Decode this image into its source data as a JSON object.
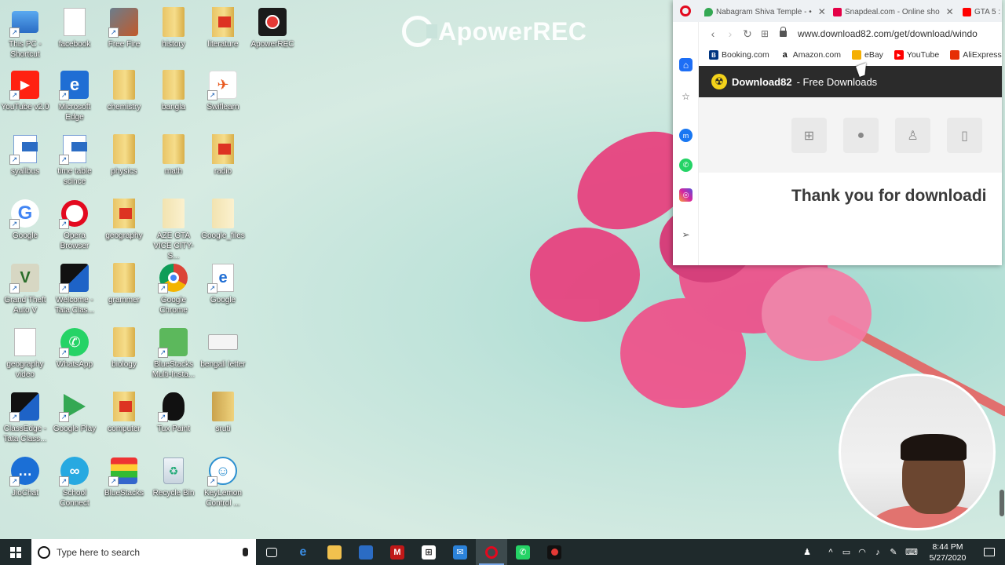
{
  "watermark": "ApowerREC",
  "desktop_icons": [
    {
      "label": "This PC - Shortcut"
    },
    {
      "label": "facebook"
    },
    {
      "label": "Free Fire"
    },
    {
      "label": "history"
    },
    {
      "label": "literature"
    },
    {
      "label": "ApowerREC"
    },
    {
      "label": "YouTube v2.0"
    },
    {
      "label": "Microsoft Edge"
    },
    {
      "label": "chemistry"
    },
    {
      "label": "bangla"
    },
    {
      "label": "Swiflearn"
    },
    {
      "label": "syallbus"
    },
    {
      "label": "time table scince"
    },
    {
      "label": "physics"
    },
    {
      "label": "math"
    },
    {
      "label": "radio"
    },
    {
      "label": "Google"
    },
    {
      "label": "Opera Browser"
    },
    {
      "label": "geography"
    },
    {
      "label": "AZE GTA VICE CITY-S..."
    },
    {
      "label": "Google_files"
    },
    {
      "label": "Grand Theft Auto V"
    },
    {
      "label": "Welcome - Tata Clas..."
    },
    {
      "label": "grammer"
    },
    {
      "label": "Google Chrome"
    },
    {
      "label": "Google"
    },
    {
      "label": "geography video"
    },
    {
      "label": "WhatsApp"
    },
    {
      "label": "biology"
    },
    {
      "label": "BlueStacks Multi-Insta..."
    },
    {
      "label": "bengali letter"
    },
    {
      "label": "ClassEdge - Tata Class..."
    },
    {
      "label": "Google Play"
    },
    {
      "label": "computer"
    },
    {
      "label": "Tux Paint"
    },
    {
      "label": "sruti"
    },
    {
      "label": "JioChat"
    },
    {
      "label": "School Connect"
    },
    {
      "label": "BlueStacks"
    },
    {
      "label": "Recycle Bin"
    },
    {
      "label": "KeyLemon Control ..."
    }
  ],
  "browser": {
    "tabs": [
      {
        "label": "Nabagram Shiva Temple - •"
      },
      {
        "label": "Snapdeal.com - Online sho"
      },
      {
        "label": "GTA 5 :"
      }
    ],
    "url": "www.download82.com/get/download/windo",
    "bookmarks": [
      "Booking.com",
      "Amazon.com",
      "eBay",
      "YouTube",
      "AliExpress"
    ],
    "site_title_bold": "Download82",
    "site_title_rest": " - Free Downloads",
    "thank_you": "Thank you for downloadi"
  },
  "taskbar": {
    "search_placeholder": "Type here to search",
    "time": "8:44 PM",
    "date": "5/27/2020"
  }
}
